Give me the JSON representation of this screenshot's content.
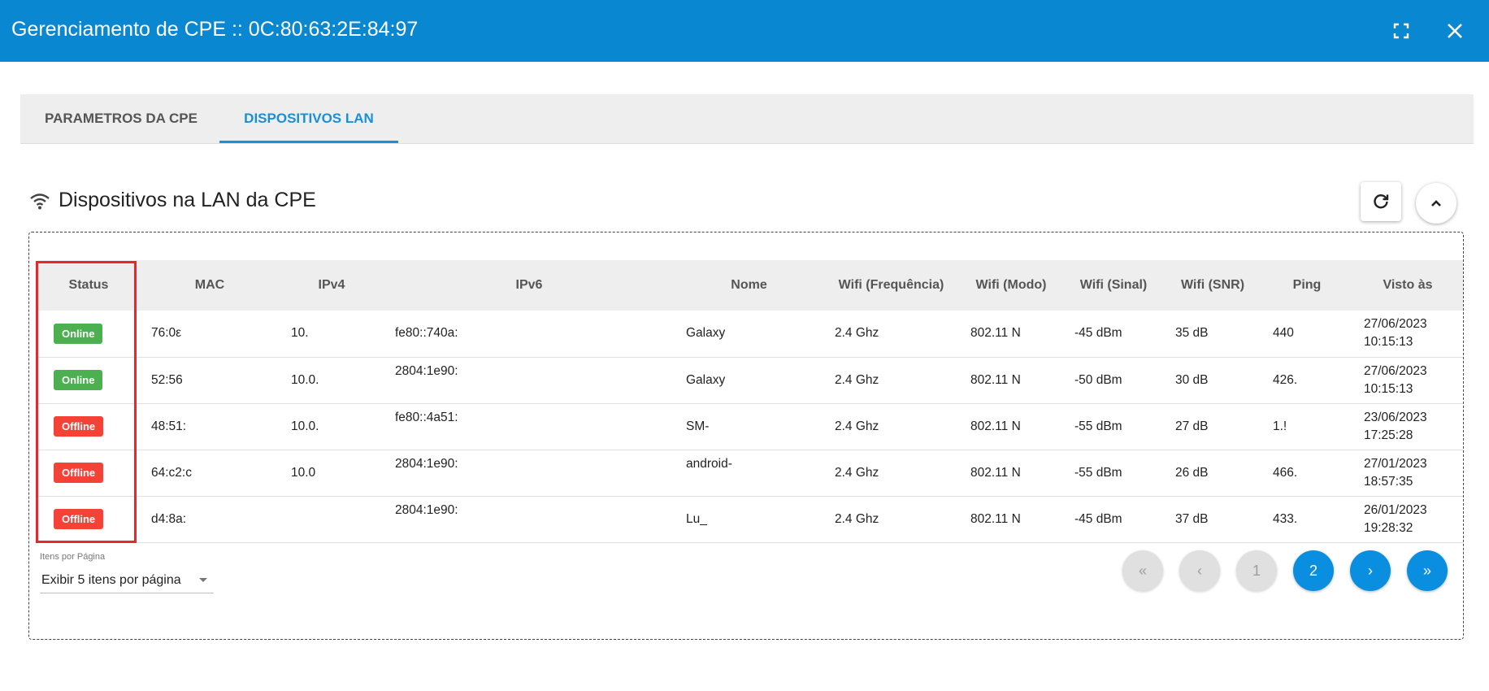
{
  "dialog": {
    "title": "Gerenciamento de CPE :: 0C:80:63:2E:84:97"
  },
  "tabs": [
    {
      "label": "PARAMETROS DA CPE"
    },
    {
      "label": "DISPOSITIVOS LAN"
    }
  ],
  "section": {
    "title": "Dispositivos na LAN da CPE"
  },
  "table": {
    "headers": [
      "Status",
      "MAC",
      "IPv4",
      "IPv6",
      "Nome",
      "Wifi (Frequência)",
      "Wifi (Modo)",
      "Wifi (Sinal)",
      "Wifi (SNR)",
      "Ping",
      "Visto às"
    ],
    "rows": [
      {
        "status": "Online",
        "mac": "76:0ε",
        "ipv4": "10.",
        "ipv6": "fe80::740a:",
        "nome": "Galaxy",
        "freq": "2.4 Ghz",
        "modo": "802.11 N",
        "sinal": "-45 dBm",
        "snr": "35 dB",
        "ping": "440",
        "date": "27/06/2023",
        "time": "10:15:13"
      },
      {
        "status": "Online",
        "mac": "52:56",
        "ipv4": "10.0.",
        "ipv6": "2804:1e90:",
        "nome": "Galaxy",
        "freq": "2.4 Ghz",
        "modo": "802.11 N",
        "sinal": "-50 dBm",
        "snr": "30 dB",
        "ping": "426.",
        "date": "27/06/2023",
        "time": "10:15:13"
      },
      {
        "status": "Offline",
        "mac": "48:51:",
        "ipv4": "10.0.",
        "ipv6": "fe80::4a51:",
        "nome": "SM-",
        "freq": "2.4 Ghz",
        "modo": "802.11 N",
        "sinal": "-55 dBm",
        "snr": "27 dB",
        "ping": "1.!",
        "date": "23/06/2023",
        "time": "17:25:28"
      },
      {
        "status": "Offline",
        "mac": "64:c2:c",
        "ipv4": "10.0",
        "ipv6": "2804:1e90:",
        "nome": "android-",
        "freq": "2.4 Ghz",
        "modo": "802.11 N",
        "sinal": "-55 dBm",
        "snr": "26 dB",
        "ping": "466.",
        "date": "27/01/2023",
        "time": "18:57:35"
      },
      {
        "status": "Offline",
        "mac": "d4:8a:",
        "ipv4": "",
        "ipv6": "2804:1e90:",
        "nome": "Lu_",
        "freq": "2.4 Ghz",
        "modo": "802.11 N",
        "sinal": "-45 dBm",
        "snr": "37 dB",
        "ping": "433.",
        "date": "26/01/2023",
        "time": "19:28:32"
      }
    ]
  },
  "pagination": {
    "per_page_label": "Itens por Página",
    "per_page_value": "Exibir 5 itens por página",
    "first": "«",
    "prev": "‹",
    "pages": [
      "1",
      "2"
    ],
    "current_page": "2",
    "next": "›",
    "last": "»"
  },
  "colors": {
    "header_bg": "#0a87d1",
    "tab_active": "#1a8fd6",
    "online": "#4caf50",
    "offline": "#f44336",
    "highlight": "#e8262b"
  },
  "icons": [
    "fullscreen-icon",
    "close-icon",
    "wifi-icon",
    "refresh-icon",
    "chevron-up-icon"
  ]
}
